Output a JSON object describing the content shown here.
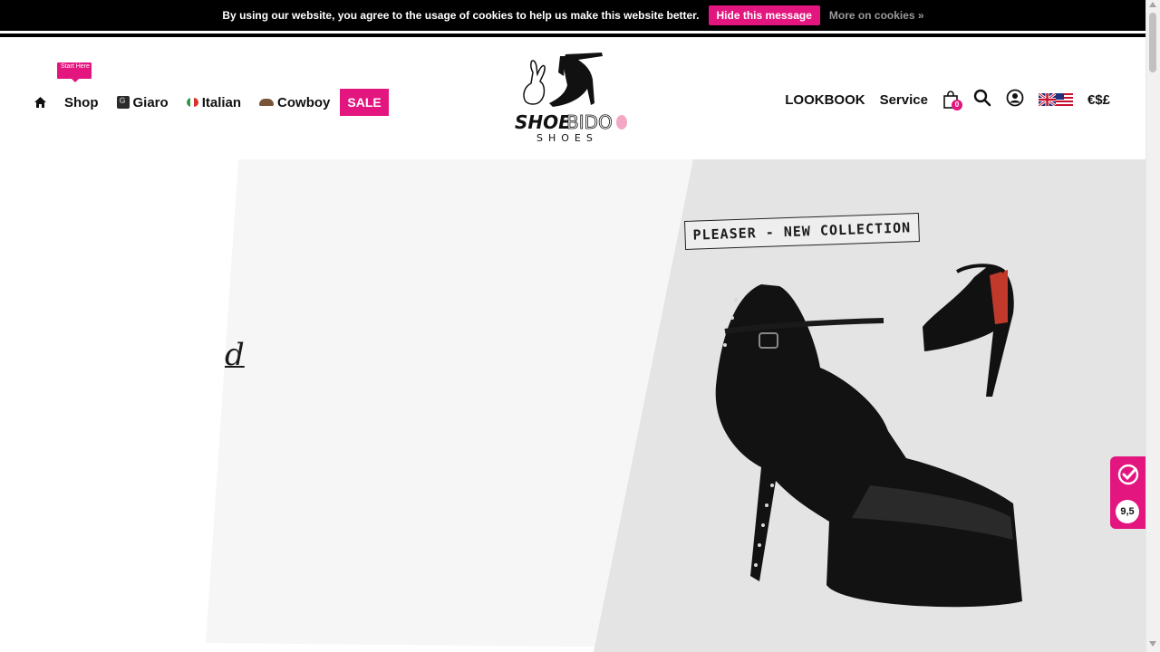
{
  "cookie_bar": {
    "message": "By using our website, you agree to the usage of cookies to help us make this website better.",
    "hide_label": "Hide this message",
    "more_label": "More on cookies »"
  },
  "nav_left": {
    "start_tag": "Start Here",
    "items": [
      {
        "label": "Shop"
      },
      {
        "label": "Giaro"
      },
      {
        "label": "Italian"
      },
      {
        "label": "Cowboy"
      },
      {
        "label": "SALE"
      }
    ]
  },
  "logo": {
    "brand_text": "SHOEBIDOO",
    "sub_text": "SHOES"
  },
  "nav_right": {
    "lookbook_label": "LOOKBOOK",
    "service_label": "Service",
    "cart_count": "0",
    "currency_label": "€$£"
  },
  "hero": {
    "partial_text": "d",
    "collection_label": "PLEASER - NEW COLLECTION"
  },
  "rating": {
    "score": "9,5"
  },
  "colors": {
    "accent": "#e3157f",
    "topbar": "#000000",
    "hero_grey": "#e6e6e6"
  }
}
